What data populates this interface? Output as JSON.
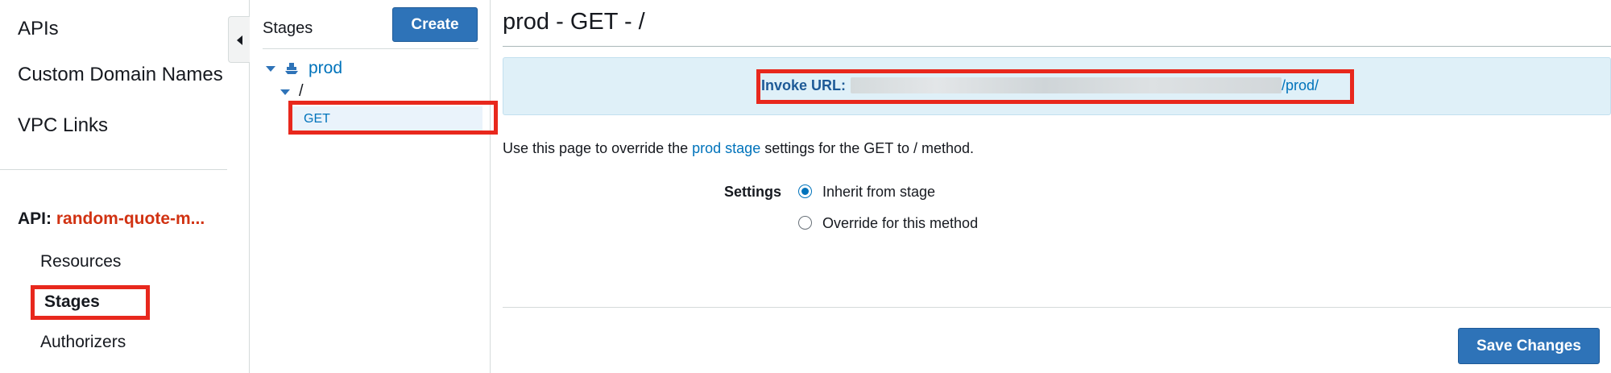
{
  "sidebar": {
    "links": [
      "APIs",
      "Custom Domain Names",
      "VPC Links"
    ],
    "api_label": "API:",
    "api_name": "random-quote-m...",
    "sub_links": [
      "Resources",
      "Stages",
      "Authorizers"
    ],
    "active_sub_link": "Stages"
  },
  "stages_panel": {
    "title": "Stages",
    "create_label": "Create",
    "tree": {
      "stage": "prod",
      "path": "/",
      "method": "GET"
    }
  },
  "main": {
    "title": "prod - GET - /",
    "invoke_label": "Invoke URL:",
    "invoke_url_suffix": "/prod/",
    "description": {
      "prefix": "Use this page to override the ",
      "link": "prod stage",
      "suffix": " settings for the GET to / method."
    },
    "settings_label": "Settings",
    "options": [
      {
        "label": "Inherit from stage",
        "checked": true
      },
      {
        "label": "Override for this method",
        "checked": false
      }
    ],
    "save_label": "Save Changes"
  },
  "colors": {
    "primary": "#2e73b8",
    "link": "#0073bb",
    "api_name": "#d13212",
    "highlight": "#e8281d",
    "invoke_bg": "#dff0f8"
  }
}
